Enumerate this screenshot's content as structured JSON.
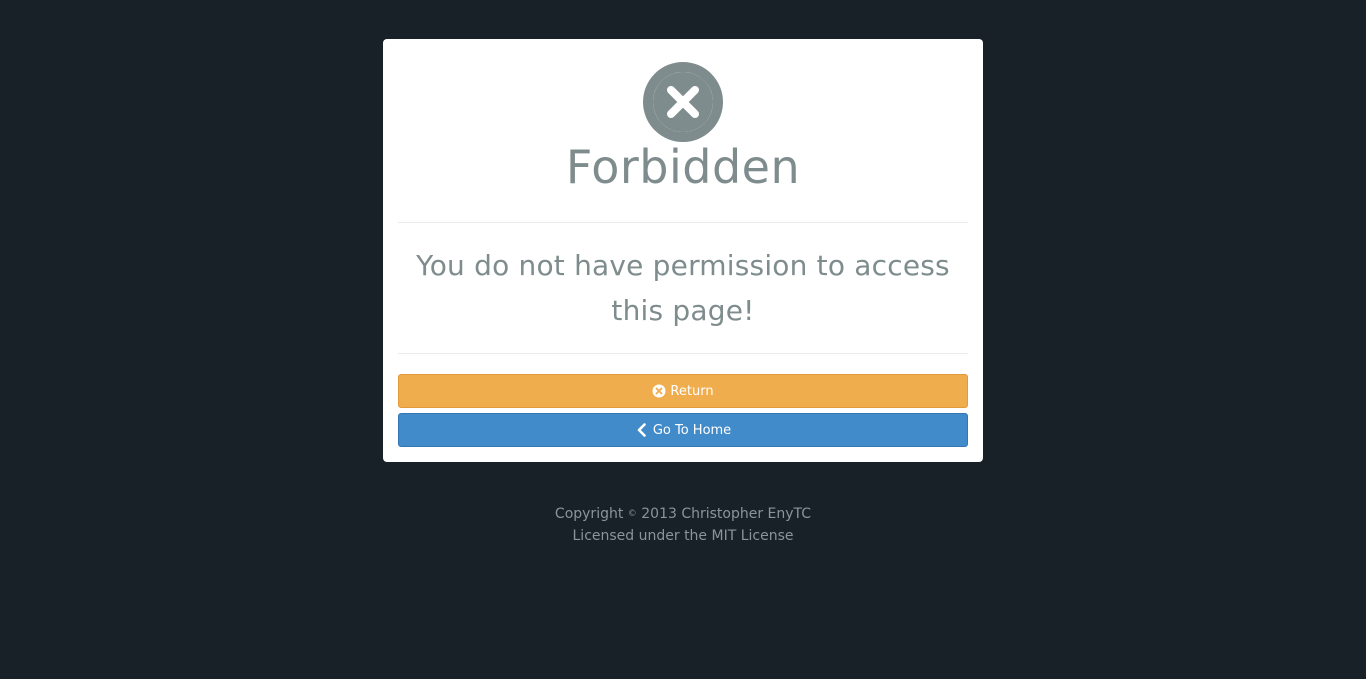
{
  "panel": {
    "icon": "times-circle-icon",
    "title": "Forbidden",
    "message": "You do not have permission to access this page!"
  },
  "buttons": {
    "return_label": "Return",
    "return_icon": "times-circle-icon",
    "home_label": "Go To Home",
    "home_icon": "chevron-left-icon"
  },
  "footer": {
    "copyright_prefix": "Copyright",
    "copyright_symbol": "©",
    "copyright_text": "2013 Christopher EnyTC",
    "license": "Licensed under the MIT License"
  },
  "colors": {
    "background": "#182028",
    "panel": "#ffffff",
    "text_muted": "#7f8c8d",
    "warning": "#f0ad4e",
    "primary": "#428bca"
  }
}
